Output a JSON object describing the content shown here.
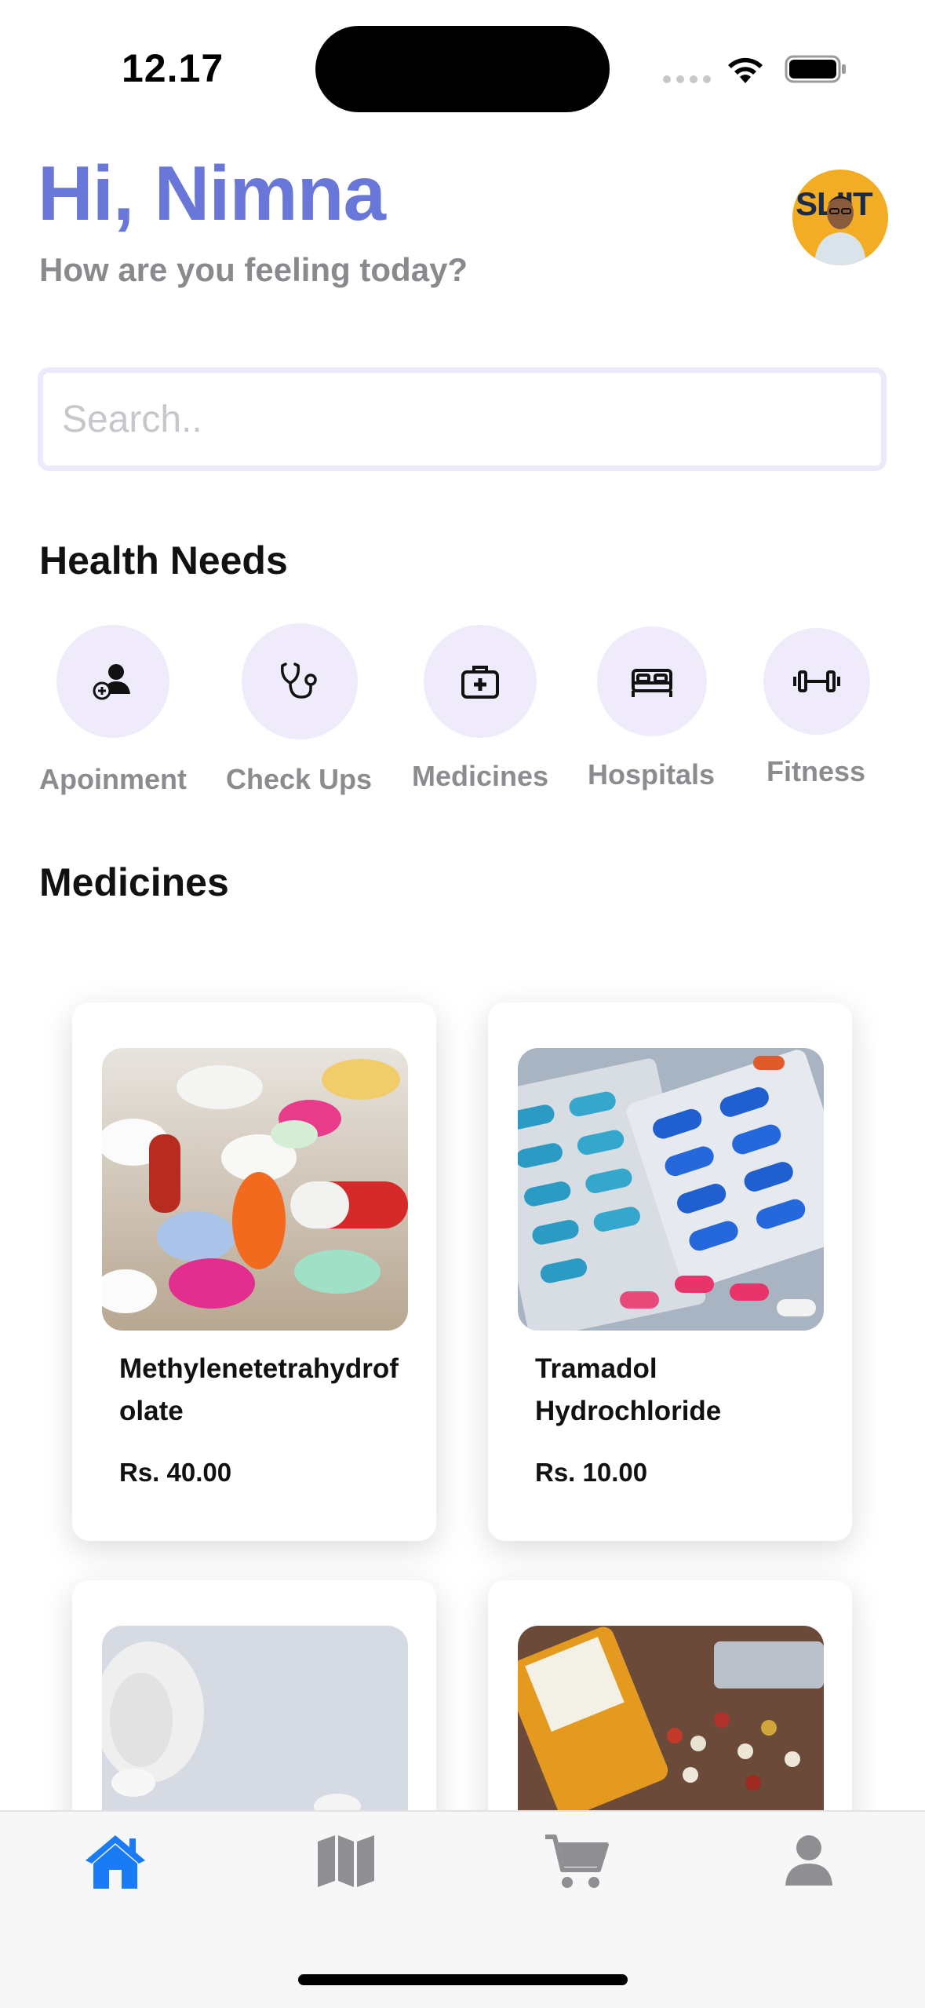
{
  "status_bar": {
    "time": "12.17"
  },
  "header": {
    "greeting": "Hi, Nimna",
    "subtitle": "How are you feeling today?",
    "avatar_text": "SLIIT"
  },
  "search": {
    "placeholder": "Search.."
  },
  "health_needs": {
    "title": "Health Needs",
    "items": [
      {
        "label": "Apoinment",
        "icon": "add-user-icon"
      },
      {
        "label": "Check Ups",
        "icon": "stethoscope-icon"
      },
      {
        "label": "Medicines",
        "icon": "medical-kit-icon"
      },
      {
        "label": "Hospitals",
        "icon": "bed-icon"
      },
      {
        "label": "Fitness",
        "icon": "dumbbell-icon"
      }
    ]
  },
  "medicines": {
    "title": "Medicines",
    "items": [
      {
        "name": "Methylenetetrahydrofolate",
        "price": "Rs. 40.00",
        "image": "assorted-pills-image"
      },
      {
        "name": "Tramadol Hydrochloride",
        "price": "Rs. 10.00",
        "image": "capsule-blister-packs-image"
      },
      {
        "name": "",
        "price": "",
        "image": "white-pills-bottle-image"
      },
      {
        "name": "",
        "price": "",
        "image": "pill-bottle-tablets-image"
      }
    ]
  },
  "tab_bar": {
    "items": [
      {
        "icon": "home-icon",
        "active": true
      },
      {
        "icon": "map-icon",
        "active": false
      },
      {
        "icon": "cart-icon",
        "active": false
      },
      {
        "icon": "profile-icon",
        "active": false
      }
    ],
    "active_color": "#1a7cf5",
    "inactive_color": "#8e8e93"
  },
  "colors": {
    "accent": "#6877d8",
    "icon_circle": "#efebfb"
  }
}
